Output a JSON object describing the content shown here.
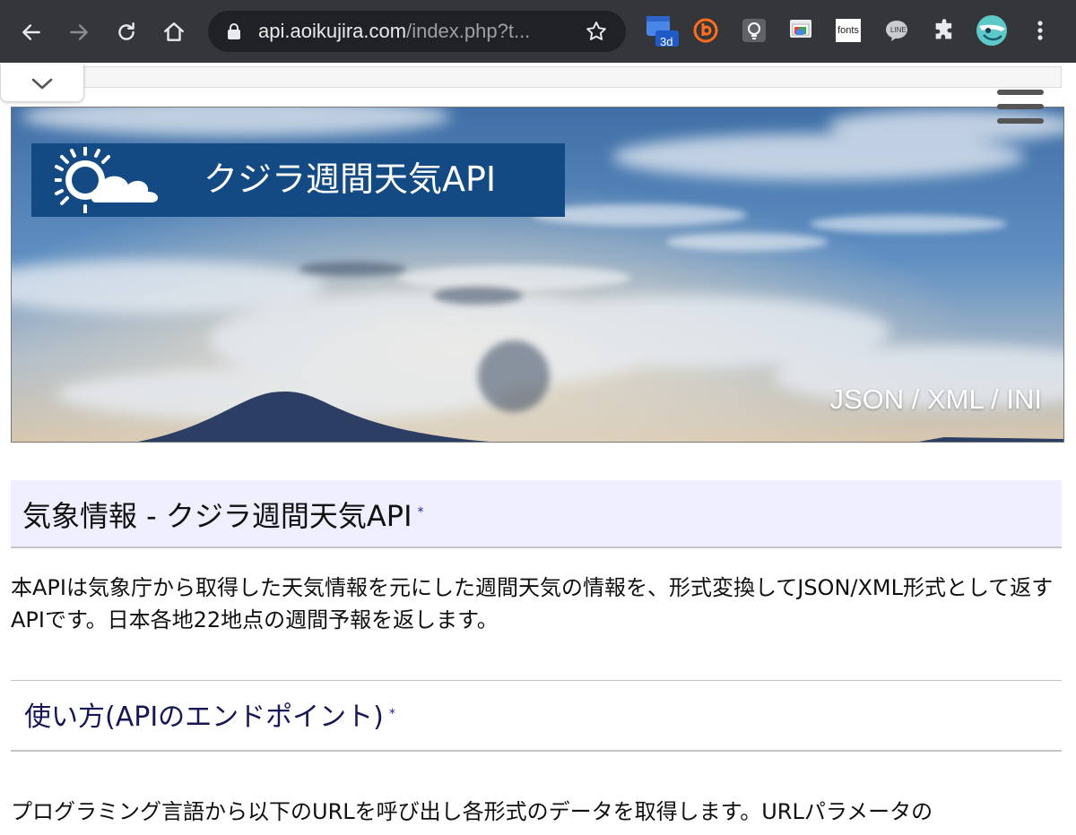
{
  "browser": {
    "url_host": "api.aoikujira.com",
    "url_path": "/index.php?t...",
    "extensions": [
      {
        "name": "3d-extension",
        "badge": "3d"
      },
      {
        "name": "b-extension"
      },
      {
        "name": "lightbulb-extension"
      },
      {
        "name": "window-extension"
      },
      {
        "name": "fonts-extension",
        "label": "fonts"
      },
      {
        "name": "line-extension",
        "label": "LINE"
      },
      {
        "name": "puzzle-extensions"
      },
      {
        "name": "profile-avatar"
      }
    ],
    "colors": {
      "toolbar": "#35363a",
      "omnibox": "#202124"
    }
  },
  "hero": {
    "title": "クジラ週間天気API",
    "formats": "JSON / XML / INI"
  },
  "section_main": {
    "heading": "気象情報 - クジラ週間天気API",
    "anchor": "*",
    "intro": "本APIは気象庁から取得した天気情報を元にした週間天気の情報を、形式変換してJSON/XML形式として返すAPIです。日本各地22地点の週間予報を返します。"
  },
  "section_usage": {
    "heading": "使い方(APIのエンドポイント)",
    "anchor": "*",
    "text": "プログラミング言語から以下のURLを呼び出し各形式のデータを取得します。URLパラメータの"
  }
}
